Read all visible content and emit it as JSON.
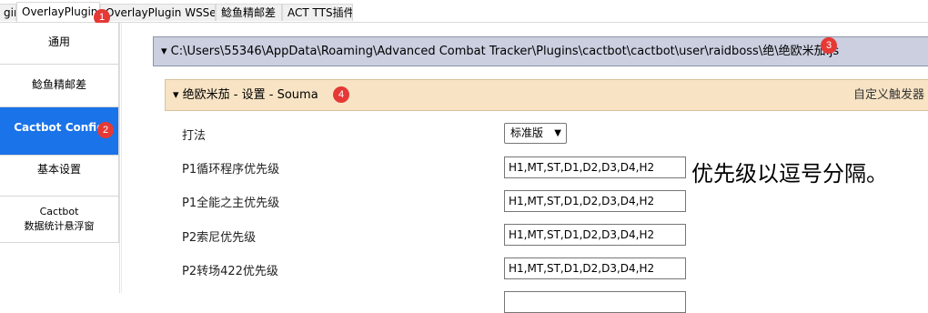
{
  "tabs": [
    {
      "label": "gin"
    },
    {
      "label": "OverlayPlugin.dll"
    },
    {
      "label": "OverlayPlugin WSServer"
    },
    {
      "label": "鲶鱼精邮差"
    },
    {
      "label": "ACT TTS插件"
    }
  ],
  "badges": [
    "1",
    "2",
    "3",
    "4"
  ],
  "sidebar": {
    "items": [
      {
        "label": "通用"
      },
      {
        "label": "鲶鱼精邮差"
      },
      {
        "label": "Cactbot Config"
      },
      {
        "label": "基本设置"
      },
      {
        "label_line1": "Cactbot",
        "label_line2": "数据统计悬浮窗"
      }
    ]
  },
  "main": {
    "path": "C:\\Users\\55346\\AppData\\Roaming\\Advanced Combat Tracker\\Plugins\\cactbot\\cactbot\\user\\raidboss\\绝\\绝欧米茄.js",
    "trigger_title": "绝欧米茄 - 设置 - Souma",
    "custom_trigger": "自定义触发器",
    "rows": [
      {
        "label": "打法",
        "value": "标准版"
      },
      {
        "label": "P1循环程序优先级",
        "value": "H1,MT,ST,D1,D2,D3,D4,H2"
      },
      {
        "label": "P1全能之主优先级",
        "value": "H1,MT,ST,D1,D2,D3,D4,H2"
      },
      {
        "label": "P2索尼优先级",
        "value": "H1,MT,ST,D1,D2,D3,D4,H2"
      },
      {
        "label": "P2转场422优先级",
        "value": "H1,MT,ST,D1,D2,D3,D4,H2"
      }
    ],
    "note": "优先级以逗号分隔。"
  }
}
